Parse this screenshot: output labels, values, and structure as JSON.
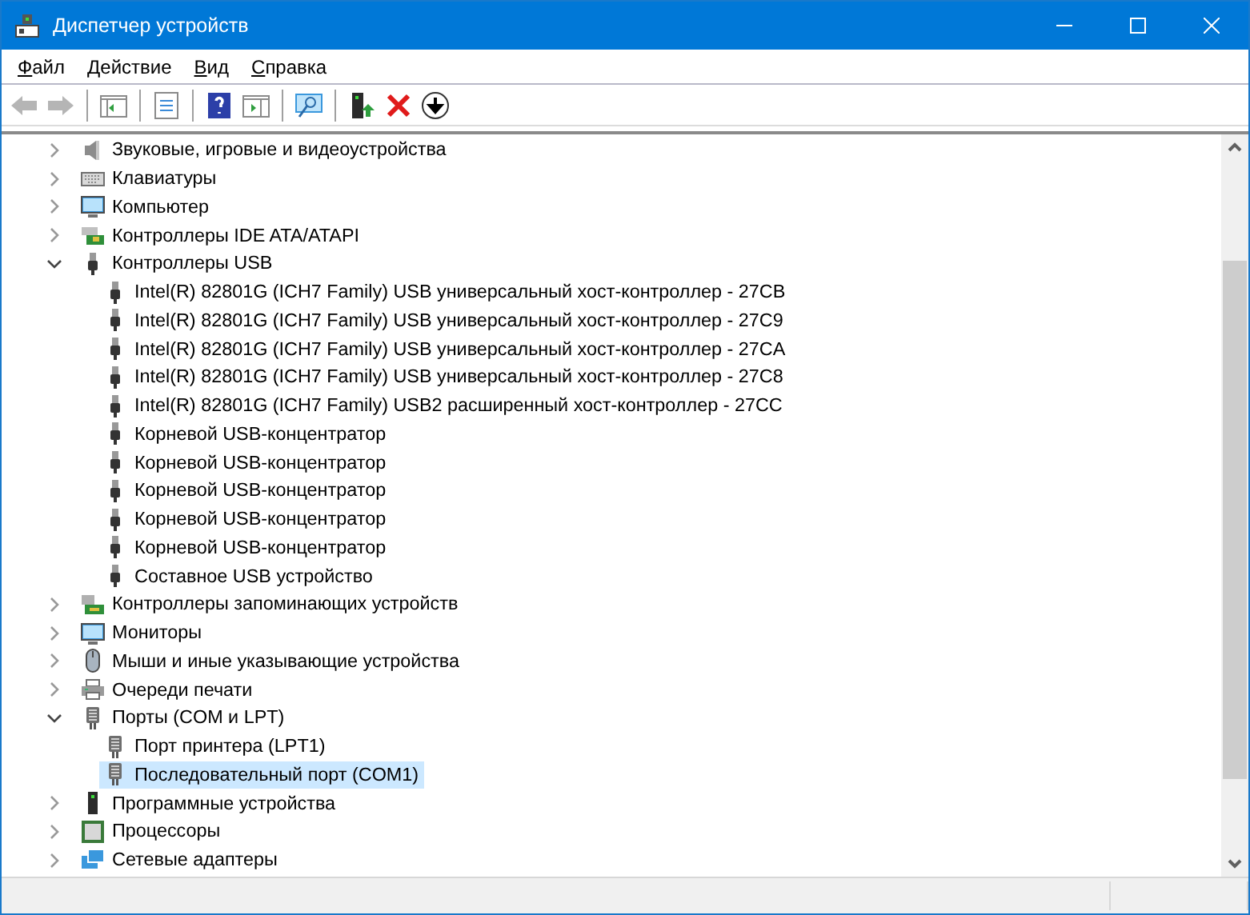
{
  "window": {
    "title": "Диспетчер устройств"
  },
  "menu": [
    {
      "label": "Файл"
    },
    {
      "label": "Действие"
    },
    {
      "label": "Вид"
    },
    {
      "label": "Справка"
    }
  ],
  "toolbar": [
    {
      "kind": "back",
      "disabled": true
    },
    {
      "kind": "forward",
      "disabled": true
    },
    {
      "kind": "separator"
    },
    {
      "kind": "tree-pane",
      "disabled": false
    },
    {
      "kind": "separator"
    },
    {
      "kind": "properties",
      "disabled": false
    },
    {
      "kind": "separator"
    },
    {
      "kind": "help",
      "disabled": false
    },
    {
      "kind": "action-pane",
      "disabled": false
    },
    {
      "kind": "separator"
    },
    {
      "kind": "scan",
      "disabled": false
    },
    {
      "kind": "separator"
    },
    {
      "kind": "update",
      "disabled": false
    },
    {
      "kind": "uninstall",
      "disabled": false
    },
    {
      "kind": "disable",
      "disabled": false
    }
  ],
  "tree": [
    {
      "label": "Звуковые, игровые и видеоустройства",
      "kind": "sound",
      "expanded": false,
      "selected": false
    },
    {
      "label": "Клавиатуры",
      "kind": "keyboard",
      "expanded": false,
      "selected": false
    },
    {
      "label": "Компьютер",
      "kind": "monitor",
      "expanded": false,
      "selected": false
    },
    {
      "label": "Контроллеры IDE ATA/ATAPI",
      "kind": "ide",
      "expanded": false,
      "selected": false
    },
    {
      "label": "Контроллеры USB",
      "kind": "usb",
      "expanded": true,
      "selected": false,
      "children": [
        {
          "label": "Intel(R) 82801G (ICH7 Family) USB универсальный хост-контроллер - 27CB",
          "kind": "usb",
          "selected": false
        },
        {
          "label": "Intel(R) 82801G (ICH7 Family) USB универсальный хост-контроллер - 27C9",
          "kind": "usb",
          "selected": false
        },
        {
          "label": "Intel(R) 82801G (ICH7 Family) USB универсальный хост-контроллер - 27CA",
          "kind": "usb",
          "selected": false
        },
        {
          "label": "Intel(R) 82801G (ICH7 Family) USB универсальный хост-контроллер - 27C8",
          "kind": "usb",
          "selected": false
        },
        {
          "label": "Intel(R) 82801G (ICH7 Family) USB2 расширенный хост-контроллер - 27CC",
          "kind": "usb",
          "selected": false
        },
        {
          "label": "Корневой USB-концентратор",
          "kind": "usb",
          "selected": false
        },
        {
          "label": "Корневой USB-концентратор",
          "kind": "usb",
          "selected": false
        },
        {
          "label": "Корневой USB-концентратор",
          "kind": "usb",
          "selected": false
        },
        {
          "label": "Корневой USB-концентратор",
          "kind": "usb",
          "selected": false
        },
        {
          "label": "Корневой USB-концентратор",
          "kind": "usb",
          "selected": false
        },
        {
          "label": "Составное USB устройство",
          "kind": "usb",
          "selected": false
        }
      ]
    },
    {
      "label": "Контроллеры запоминающих устройств",
      "kind": "storage",
      "expanded": false,
      "selected": false
    },
    {
      "label": "Мониторы",
      "kind": "monitor",
      "expanded": false,
      "selected": false
    },
    {
      "label": "Мыши и иные указывающие устройства",
      "kind": "mouse",
      "expanded": false,
      "selected": false
    },
    {
      "label": "Очереди печати",
      "kind": "printer",
      "expanded": false,
      "selected": false
    },
    {
      "label": "Порты (COM и LPT)",
      "kind": "port",
      "expanded": true,
      "selected": false,
      "children": [
        {
          "label": "Порт принтера (LPT1)",
          "kind": "port",
          "selected": false
        },
        {
          "label": "Последовательный порт (COM1)",
          "kind": "port",
          "selected": true
        }
      ]
    },
    {
      "label": "Программные устройства",
      "kind": "software",
      "expanded": false,
      "selected": false
    },
    {
      "label": "Процессоры",
      "kind": "cpu",
      "expanded": false,
      "selected": false
    },
    {
      "label": "Сетевые адаптеры",
      "kind": "network",
      "expanded": false,
      "selected": false
    }
  ]
}
